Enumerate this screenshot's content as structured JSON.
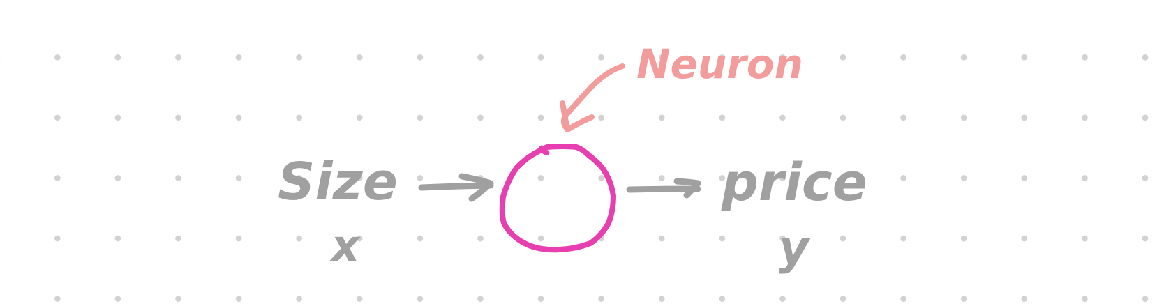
{
  "diagram": {
    "input_label": "Size",
    "input_symbol": "x",
    "output_label": "price",
    "output_symbol": "y",
    "annotation_label": "Neuron"
  },
  "colors": {
    "background": "#ffffff",
    "grid_dot": "#d2d2d2",
    "ink": "#a0a0a0",
    "neuron_circle": "#e83fb0",
    "annotation": "#f29c9c"
  },
  "icons": {
    "input_arrow": "right-arrow",
    "output_arrow": "right-arrow",
    "annotation_arrow": "curved-down-arrow"
  }
}
